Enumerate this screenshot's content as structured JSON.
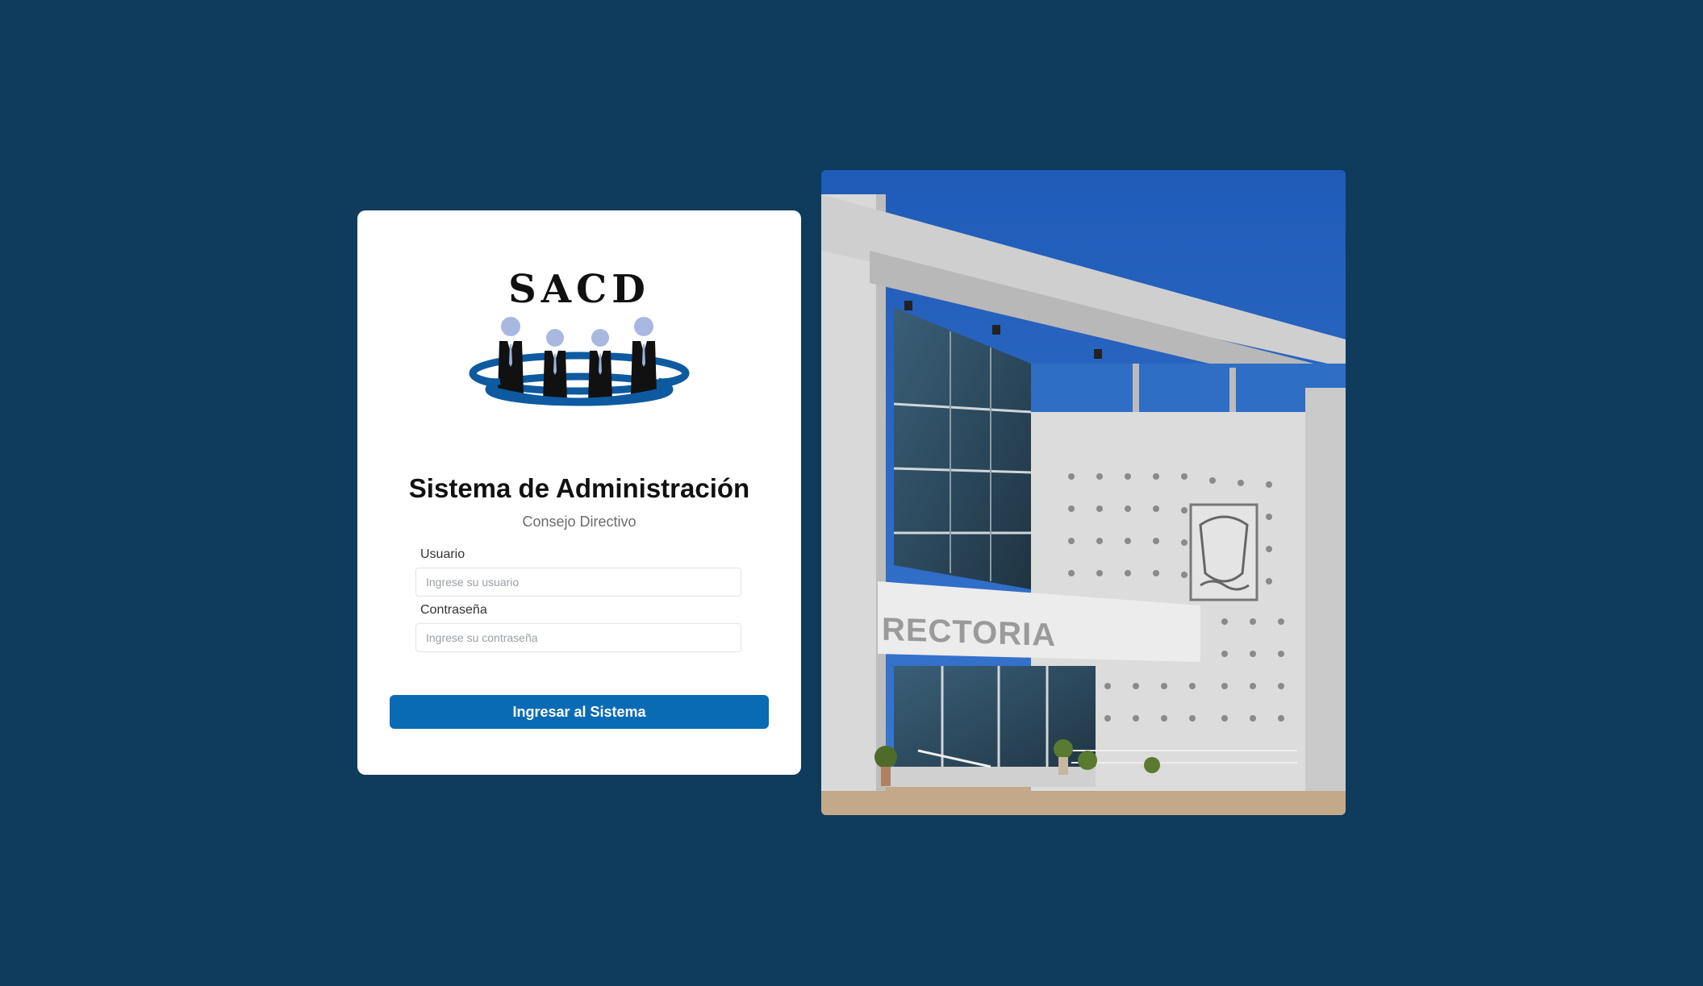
{
  "logo": {
    "text": "SACD"
  },
  "login": {
    "title": "Sistema de Administración",
    "subtitle": "Consejo Directivo",
    "username_label": "Usuario",
    "username_placeholder": "Ingrese su usuario",
    "username_value": "",
    "password_label": "Contraseña",
    "password_placeholder": "Ingrese su contraseña",
    "password_value": "",
    "submit_label": "Ingresar al Sistema"
  },
  "photo": {
    "sign_text": "RECTORIA"
  },
  "colors": {
    "background": "#0f3b5c",
    "card": "#ffffff",
    "primary_button": "#0a6bb5",
    "logo_ring": "#0d5aa0",
    "logo_head": "#a9b8e0"
  }
}
